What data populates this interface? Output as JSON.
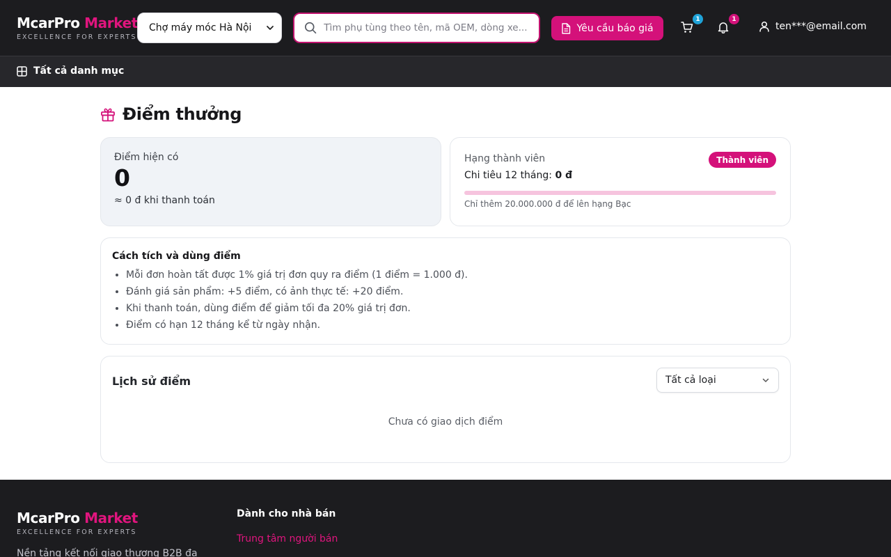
{
  "header": {
    "brand_main": "McarPro",
    "brand_accent": "Market",
    "brand_tagline": "EXCELLENCE FOR EXPERTS",
    "market_select": "Chợ máy móc Hà Nội",
    "search_placeholder": "Tìm phụ tùng theo tên, mã OEM, dòng xe...",
    "quote_button": "Yêu cầu báo giá",
    "cart_count": "1",
    "notification_count": "1",
    "account_email": "ten***@email.com"
  },
  "category_bar": {
    "all_categories": "Tất cả danh mục"
  },
  "page": {
    "title": "Điểm thưởng"
  },
  "points": {
    "label": "Điểm hiện có",
    "value": "0",
    "equivalent": "≈ 0 đ khi thanh toán"
  },
  "tier": {
    "label": "Hạng thành viên",
    "badge": "Thành viên",
    "spend_label": "Chi tiêu 12 tháng: ",
    "spend_value": "0 đ",
    "progress_percent": 0,
    "next_tier_text": "Chỉ thêm 20.000.000 đ để lên hạng Bạc"
  },
  "rules": {
    "title": "Cách tích và dùng điểm",
    "items": [
      "Mỗi đơn hoàn tất được 1% giá trị đơn quy ra điểm (1 điểm = 1.000 đ).",
      "Đánh giá sản phẩm: +5 điểm, có ảnh thực tế: +20 điểm.",
      "Khi thanh toán, dùng điểm để giảm tối đa 20% giá trị đơn.",
      "Điểm có hạn 12 tháng kể từ ngày nhận."
    ]
  },
  "history": {
    "title": "Lịch sử điểm",
    "filter_value": "Tất cả loại",
    "empty_text": "Chưa có giao dịch điểm"
  },
  "footer": {
    "brand_main": "McarPro",
    "brand_accent": "Market",
    "brand_tagline": "EXCELLENCE FOR EXPERTS",
    "description": "Nền tảng kết nối giao thương B2B đa",
    "seller_title": "Dành cho nhà bán",
    "seller_link": "Trung tâm người bán"
  },
  "colors": {
    "brand_accent": "#e0157e",
    "primary_button": "#d4117a",
    "header_bg": "#1c1c1f",
    "cart_badge": "#1fa3d8"
  },
  "icons": {
    "market_select": "chevron-down-icon",
    "search": "search-icon",
    "quote": "document-icon",
    "cart": "cart-icon",
    "notifications": "bell-icon",
    "account": "user-icon",
    "categories": "grid-icon",
    "title": "gift-icon",
    "filter": "chevron-down-icon"
  }
}
